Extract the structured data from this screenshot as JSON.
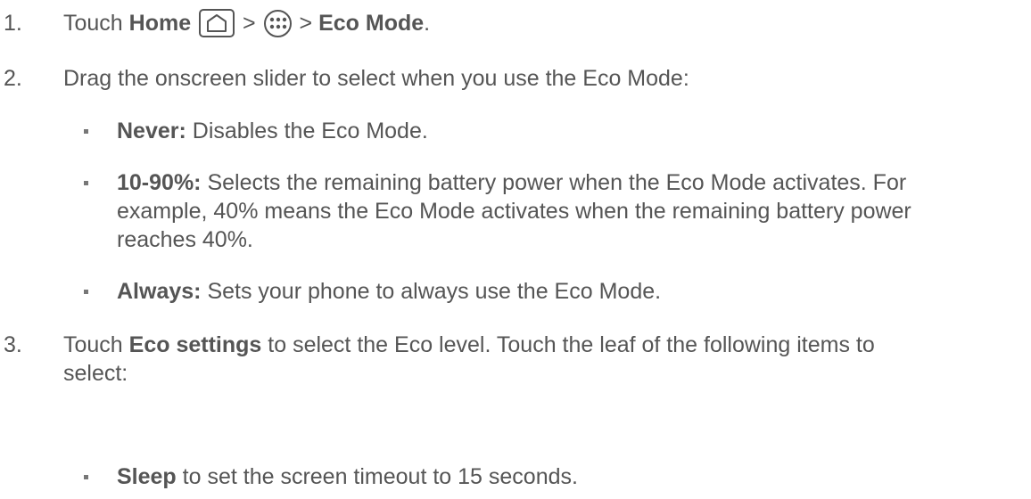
{
  "steps": [
    {
      "number": "1.",
      "parts": {
        "touch": "Touch ",
        "home": "Home",
        "sep1": " > ",
        "sep2": " > ",
        "eco_mode": "Eco Mode",
        "end": "."
      }
    },
    {
      "number": "2.",
      "text": "Drag the onscreen slider to select when you use the Eco Mode:",
      "bullets": [
        {
          "term": "Never:",
          "lines": [
            "Disables the Eco Mode."
          ]
        },
        {
          "term": "10-90%:",
          "lines": [
            "Selects the remaining battery power when the Eco Mode activates. For",
            "example, 40% means the Eco Mode activates when the remaining battery power",
            "reaches 40%."
          ]
        },
        {
          "term": "Always:",
          "lines": [
            "Sets your phone to always use the Eco Mode."
          ]
        }
      ]
    },
    {
      "number": "3.",
      "parts": {
        "touch": "Touch ",
        "eco_settings": "Eco settings",
        "rest_line1": " to select the Eco level. Touch the leaf of the following items to",
        "rest_line2": "select:"
      },
      "bullets": [
        {
          "term": "Sleep",
          "lines": [
            "to set the screen timeout to 15 seconds."
          ]
        }
      ]
    }
  ],
  "icons": {
    "home_icon": "home-icon",
    "apps_icon": "apps-icon"
  }
}
